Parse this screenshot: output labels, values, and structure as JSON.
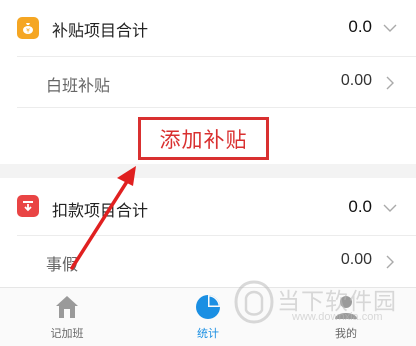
{
  "subsidy": {
    "title": "补贴项目合计",
    "total": "0.0",
    "items": [
      {
        "label": "白班补贴",
        "value": "0.00"
      }
    ],
    "add_label": "添加补贴"
  },
  "deduction": {
    "title": "扣款项目合计",
    "total": "0.0",
    "items": [
      {
        "label": "事假",
        "value": "0.00"
      }
    ]
  },
  "tabs": [
    {
      "label": "记加班",
      "icon": "home-icon",
      "active": false
    },
    {
      "label": "统计",
      "icon": "pie-chart-icon",
      "active": true
    },
    {
      "label": "我的",
      "icon": "user-icon",
      "active": false
    }
  ],
  "watermark": {
    "text": "当下软件园",
    "url": "www.downxia.com"
  },
  "colors": {
    "subsidy_icon": "#f5a623",
    "deduction_icon": "#e94444",
    "highlight": "#d93030",
    "active_tab": "#1a8fe3"
  }
}
